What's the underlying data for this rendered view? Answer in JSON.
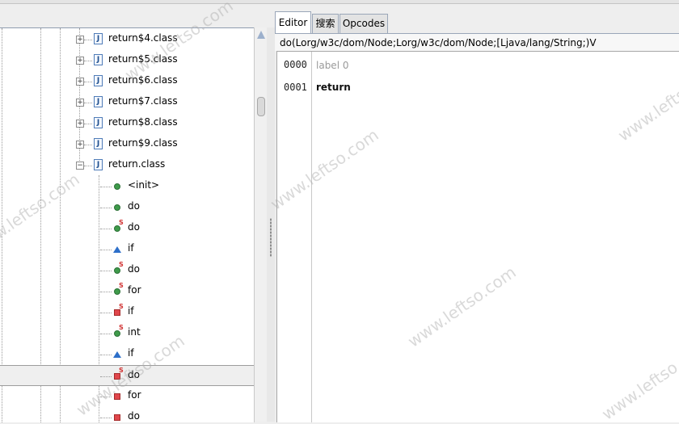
{
  "tree": {
    "classes": [
      {
        "label": "return$4.class",
        "expander": "+",
        "icon": "java-class-file-icon"
      },
      {
        "label": "return$5.class",
        "expander": "+",
        "icon": "java-class-file-icon"
      },
      {
        "label": "return$6.class",
        "expander": "+",
        "icon": "java-class-file-icon"
      },
      {
        "label": "return$7.class",
        "expander": "+",
        "icon": "java-class-file-icon"
      },
      {
        "label": "return$8.class",
        "expander": "+",
        "icon": "java-class-file-icon"
      },
      {
        "label": "return$9.class",
        "expander": "+",
        "icon": "java-class-file-icon"
      },
      {
        "label": "return.class",
        "expander": "−",
        "icon": "java-class-file-icon"
      }
    ],
    "members": [
      {
        "label": "<init>",
        "icon": "green-method-icon",
        "static": false
      },
      {
        "label": "do",
        "icon": "green-method-icon",
        "static": false
      },
      {
        "label": "do",
        "icon": "green-method-icon",
        "static": true
      },
      {
        "label": "if",
        "icon": "blue-triangle-icon",
        "static": false
      },
      {
        "label": "do",
        "icon": "green-method-icon",
        "static": true
      },
      {
        "label": "for",
        "icon": "green-method-icon",
        "static": true
      },
      {
        "label": "if",
        "icon": "red-square-icon",
        "static": true
      },
      {
        "label": "int",
        "icon": "green-method-icon",
        "static": true
      },
      {
        "label": "if",
        "icon": "blue-triangle-icon",
        "static": false
      },
      {
        "label": "do",
        "icon": "red-square-icon",
        "static": true,
        "selected": true
      },
      {
        "label": "for",
        "icon": "red-square-icon",
        "static": false
      },
      {
        "label": "do",
        "icon": "red-square-icon",
        "static": false
      }
    ],
    "static_marker": "S"
  },
  "editor": {
    "tabs": [
      {
        "label": "Editor",
        "active": true
      },
      {
        "label": "搜索",
        "active": false
      },
      {
        "label": "Opcodes",
        "active": false
      }
    ],
    "signature": "do(Lorg/w3c/dom/Node;Lorg/w3c/dom/Node;[Ljava/lang/String;)V",
    "lines": [
      {
        "num": "0000",
        "code": "label 0"
      },
      {
        "num": "0001",
        "code": "return"
      }
    ]
  },
  "watermark": "www.leftso.com"
}
